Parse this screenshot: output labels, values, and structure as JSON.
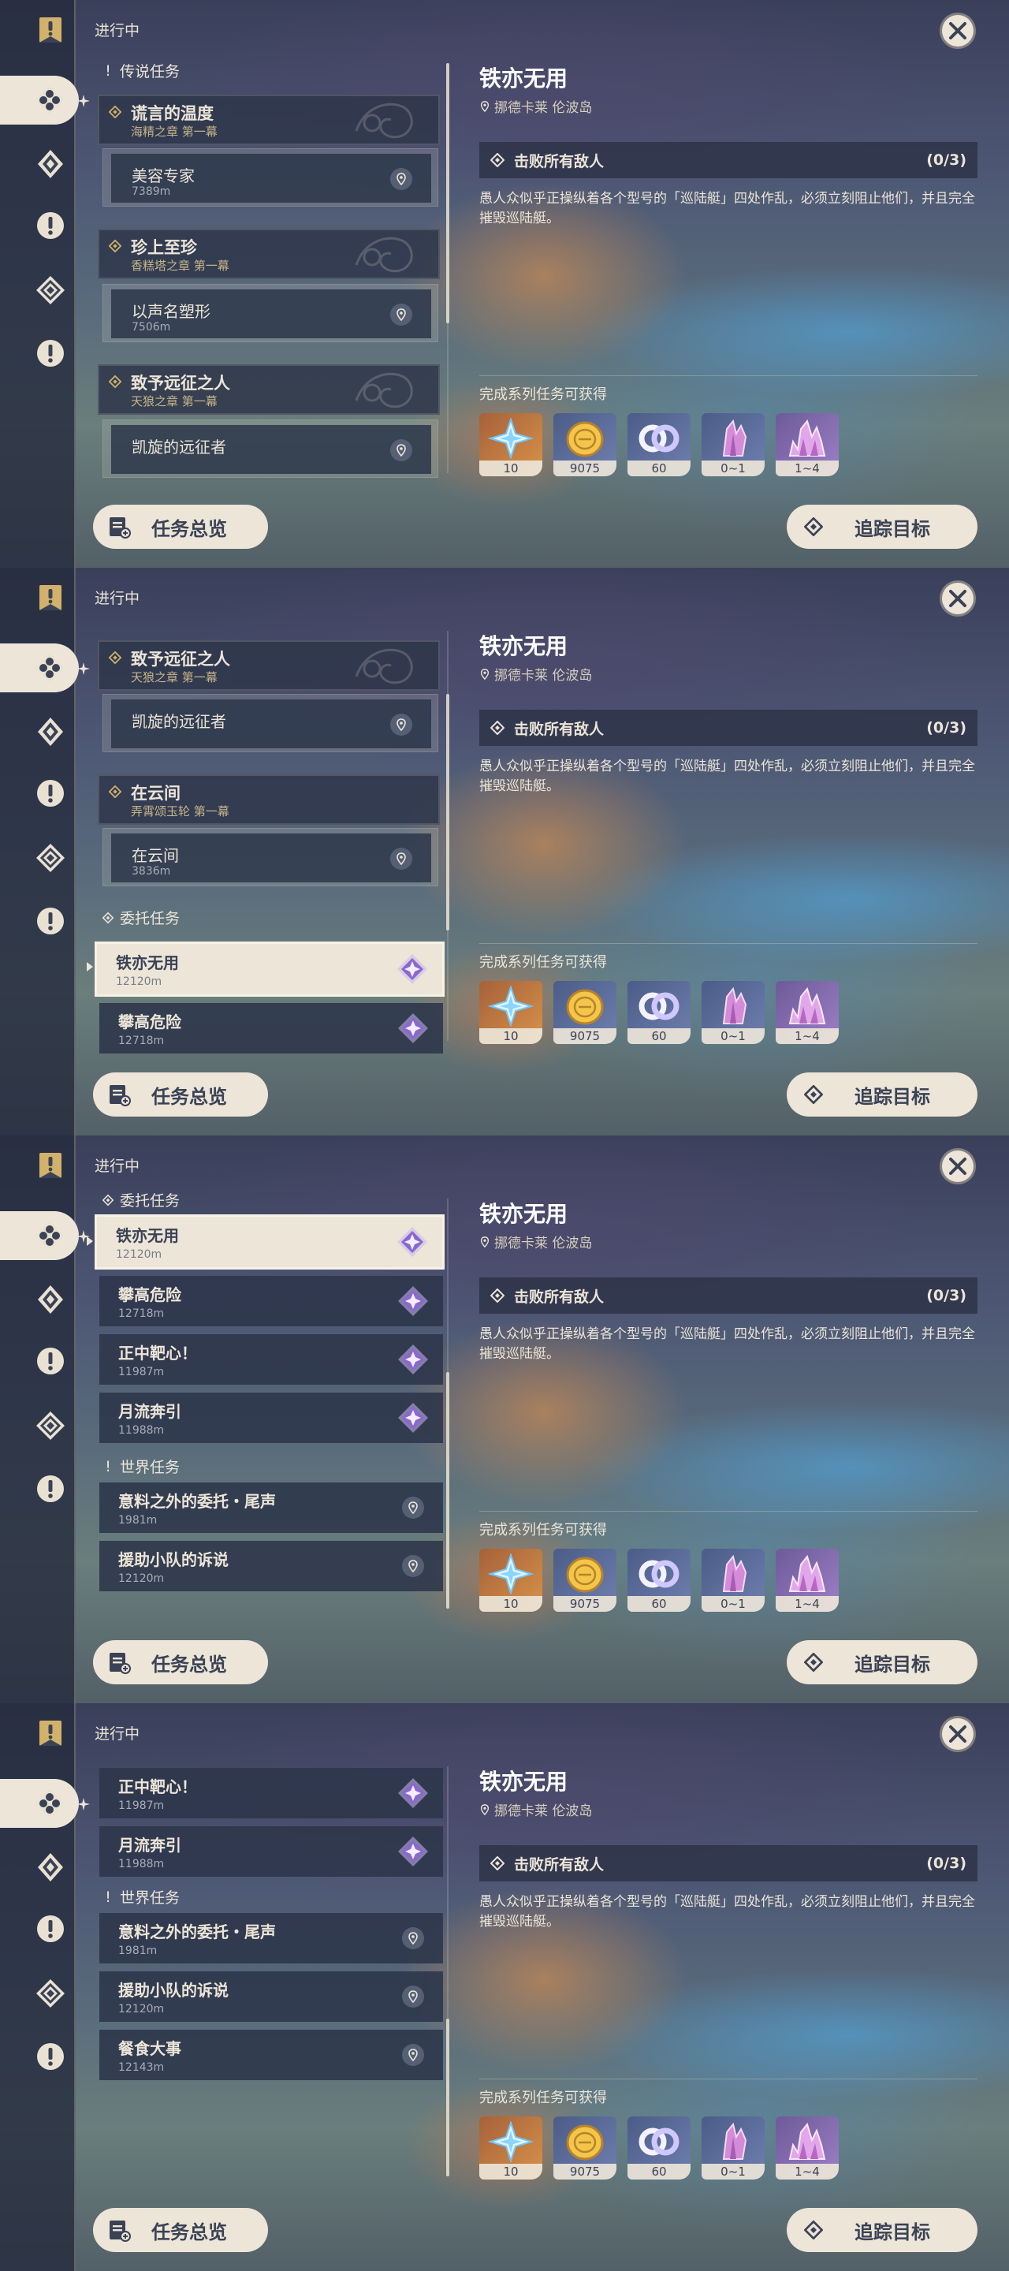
{
  "header": "进行中",
  "quest": {
    "title": "铁亦无用",
    "location": "挪德卡莱 伦波岛",
    "objective": "击败所有敌人",
    "progress": "(0/3)",
    "description": "愚人众似乎正操纵着各个型号的「巡陆艇」四处作乱，必须立刻阻止他们，并且完全摧毁巡陆艇。",
    "rewards_label": "完成系列任务可获得",
    "rewards": [
      {
        "icon": "primogem-icon",
        "amount": "10"
      },
      {
        "icon": "mora-icon",
        "amount": "9075"
      },
      {
        "icon": "friendship-exp-icon",
        "amount": "60"
      },
      {
        "icon": "crystal-chunk-icon",
        "amount": "0~1"
      },
      {
        "icon": "crystal-cluster-icon",
        "amount": "1~4"
      }
    ]
  },
  "buttons": {
    "summary": "任务总览",
    "track": "追踪目标"
  },
  "sections": {
    "legend": "传说任务",
    "commission": "委托任务",
    "world": "世界任务"
  },
  "legend_quests": [
    {
      "title": "谎言的温度",
      "subtitle": "海精之章 第一幕",
      "item": "美容专家",
      "distance": "7389m"
    },
    {
      "title": "珍上至珍",
      "subtitle": "香糕塔之章 第一幕",
      "item": "以声名塑形",
      "distance": "7506m"
    },
    {
      "title": "致予远征之人",
      "subtitle": "天狼之章 第一幕",
      "item": "凯旋的远征者",
      "distance": ""
    },
    {
      "title": "在云间",
      "subtitle": "弄霄颂玉轮 第一幕",
      "item": "在云间",
      "distance": "3836m"
    }
  ],
  "commissions": [
    {
      "title": "铁亦无用",
      "distance": "12120m"
    },
    {
      "title": "攀高危险",
      "distance": "12718m"
    },
    {
      "title": "正中靶心！",
      "distance": "11987m"
    },
    {
      "title": "月流奔引",
      "distance": "11988m"
    }
  ],
  "world_quests": [
    {
      "title": "意料之外的委托・尾声",
      "distance": "1981m"
    },
    {
      "title": "援助小队的诉说",
      "distance": "12120m"
    },
    {
      "title": "餐食大事",
      "distance": "12143m"
    }
  ],
  "colors": {
    "cream": "#ece5d8",
    "gold": "#c7b48a",
    "panel": "#2c364a",
    "reward_orange": "#d8934a",
    "reward_blue": "#6f80b0",
    "reward_purple": "#9c80c6"
  }
}
